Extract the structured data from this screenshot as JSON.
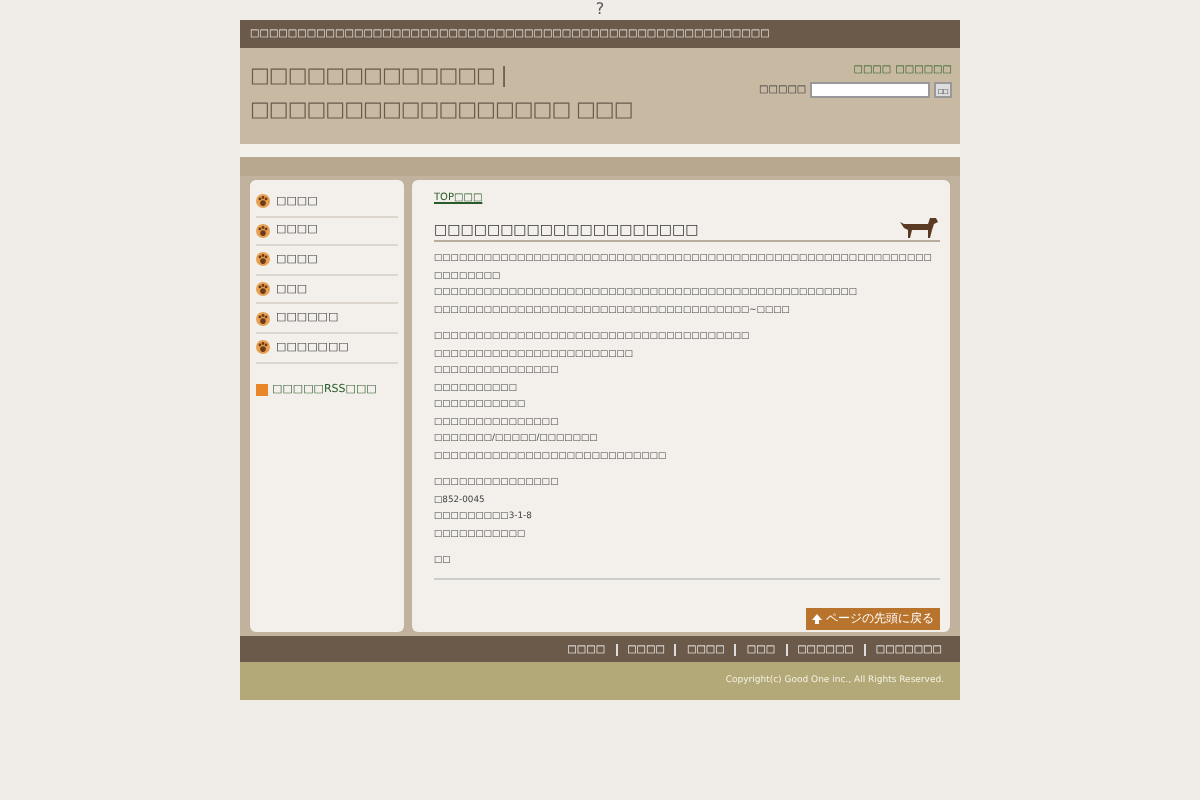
{
  "top_mark": "?",
  "top_bar": {
    "text": "□□□□□□□□□□□□□□□□□□□□□□□□□□□□□□□□□□□□□□□□□□□□□□□□□□□□□□□"
  },
  "header": {
    "title": "□□□□□□□□□□□□□ | □□□□□□□□□□□□□□□□□ □□□",
    "links": [
      "□□□□",
      "□□□□□□"
    ],
    "search_label": "□□□□□",
    "search_button": "□□"
  },
  "sidebar": {
    "items": [
      {
        "label": "□□□□",
        "selected": false
      },
      {
        "label": "□□□□",
        "selected": false
      },
      {
        "label": "□□□□",
        "selected": false
      },
      {
        "label": "□□□",
        "selected": false
      },
      {
        "label": "□□□□□□",
        "selected": false
      },
      {
        "label": "□□□□□□□",
        "selected": false
      }
    ],
    "rss": "□□□□□RSS□□□"
  },
  "main": {
    "breadcrumb": "TOP□□□",
    "heading": "□□□□□□□□□□□□□□□□□□□□",
    "paragraphs": [
      [
        "□□□□□□□□□□□□□□□□□□□□□□□□□□□□□□□□□□□□□□□□□□□□□□□□□□□□□□□□□□□□□□□□□□□□",
        "□□□□□□□□□□□□□□□□□□□□□□□□□□□□□□□□□□□□□□□□□□□□□□□□□□□",
        "□□□□□□□□□□□□□□□□□□□□□□□□□□□□□□□□□□□□□□~□□□□"
      ],
      [
        "□□□□□□□□□□□□□□□□□□□□□□□□□□□□□□□□□□□□□□",
        "□□□□□□□□□□□□□□□□□□□□□□□□",
        "□□□□□□□□□□□□□□□",
        "□□□□□□□□□□",
        "□□□□□□□□□□□",
        "□□□□□□□□□□□□□□□",
        "□□□□□□□/□□□□□/□□□□□□□",
        "□□□□□□□□□□□□□□□□□□□□□□□□□□□□"
      ],
      [
        "□□□□□□□□□□□□□□□",
        "□852-0045",
        "□□□□□□□□□3-1-8",
        "□□□□□□□□□□□"
      ],
      [
        "□□"
      ]
    ],
    "back_to_top": "ページの先頭に戻る"
  },
  "footer": {
    "links": [
      "□□□□",
      "□□□□",
      "□□□□",
      "□□□",
      "□□□□□□",
      "□□□□□□□"
    ],
    "copyright": "Copyright(c) Good One inc., All Rights Reserved."
  }
}
